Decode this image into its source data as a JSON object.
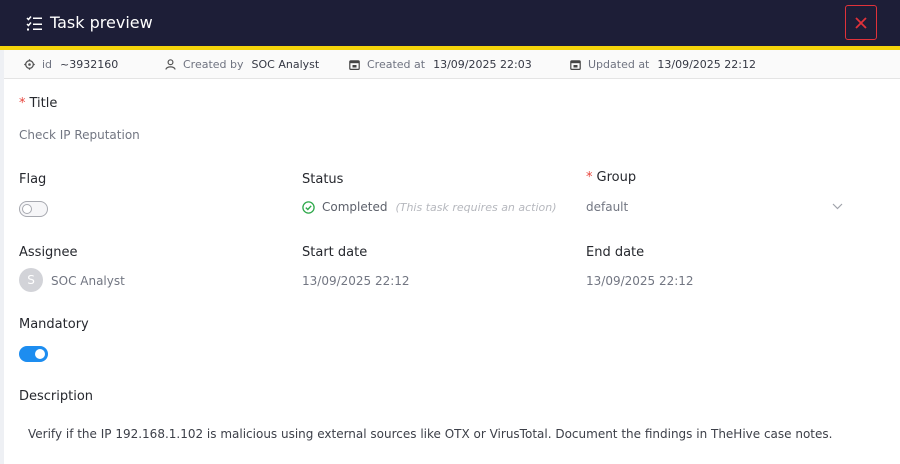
{
  "header": {
    "title": "Task preview",
    "task_icon": "task-list-icon",
    "close_icon": "close-icon"
  },
  "meta": {
    "id_label": "id",
    "id_value": "~3932160",
    "created_by_label": "Created by",
    "created_by_value": "SOC Analyst",
    "created_at_label": "Created at",
    "created_at_value": "13/09/2025 22:03",
    "updated_at_label": "Updated at",
    "updated_at_value": "13/09/2025 22:12"
  },
  "fields": {
    "title_label": "Title",
    "title_value": "Check IP Reputation",
    "flag_label": "Flag",
    "flag_on": false,
    "status_label": "Status",
    "status_value": "Completed",
    "status_note": "(This task requires an action)",
    "group_label": "Group",
    "group_value": "default",
    "assignee_label": "Assignee",
    "assignee_initial": "S",
    "assignee_value": "SOC Analyst",
    "start_date_label": "Start date",
    "start_date_value": "13/09/2025 22:12",
    "end_date_label": "End date",
    "end_date_value": "13/09/2025 22:12",
    "mandatory_label": "Mandatory",
    "mandatory_on": true,
    "description_label": "Description",
    "description_value": "Verify if the IP 192.168.1.102 is malicious using external sources like OTX or VirusTotal. Document the findings in TheHive case notes."
  },
  "required_mark": "*",
  "colors": {
    "header_bg": "#1d1e37",
    "accent": "#f5d40b",
    "close": "#e0323a",
    "toggle_on": "#1d8df0",
    "status_ok": "#2ea84a",
    "required": "#e8443c"
  }
}
